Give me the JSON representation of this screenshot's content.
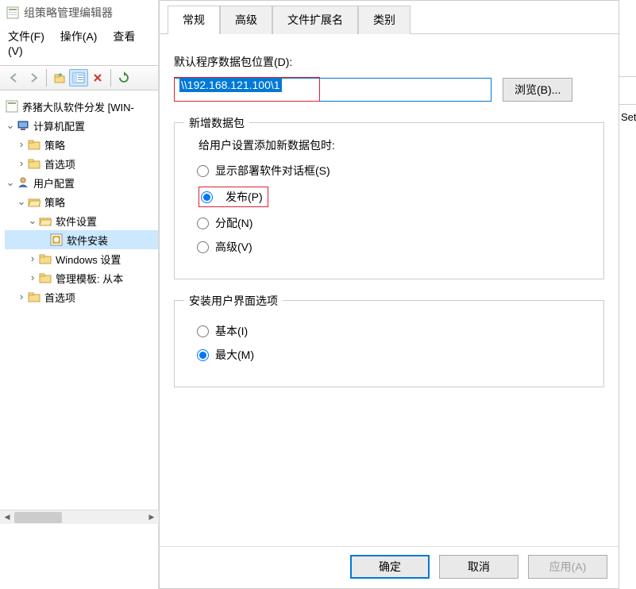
{
  "app": {
    "title": "组策略管理编辑器"
  },
  "menus": {
    "file": "文件(F)",
    "action": "操作(A)",
    "view": "查看(V)"
  },
  "tree": {
    "root": "养猪大队软件分发 [WIN-",
    "computerCfg": "计算机配置",
    "computerCfg_policy": "策略",
    "computerCfg_pref": "首选项",
    "userCfg": "用户配置",
    "userCfg_policy": "策略",
    "userCfg_policy_sw": "软件设置",
    "userCfg_policy_sw_install": "软件安装",
    "userCfg_policy_win": "Windows 设置",
    "userCfg_policy_tmpl": "管理模板: 从本",
    "userCfg_pref": "首选项"
  },
  "tabs": {
    "general": "常规",
    "advanced": "高级",
    "ext": "文件扩展名",
    "category": "类别"
  },
  "form": {
    "pathLabel": "默认程序数据包位置(D):",
    "pathValue": "\\\\192.168.121.100\\1",
    "browse": "浏览(B)...",
    "groupNew": "新增数据包",
    "newLabel": "给用户设置添加新数据包时:",
    "radioDialog": "显示部署软件对话框(S)",
    "radioPublish": "发布(P)",
    "radioAssign": "分配(N)",
    "radioAdvanced": "高级(V)",
    "groupUi": "安装用户界面选项",
    "radioBasic": "基本(I)",
    "radioMax": "最大(M)"
  },
  "buttons": {
    "ok": "确定",
    "cancel": "取消",
    "apply": "应用(A)"
  },
  "peek": {
    "text": "Set"
  }
}
